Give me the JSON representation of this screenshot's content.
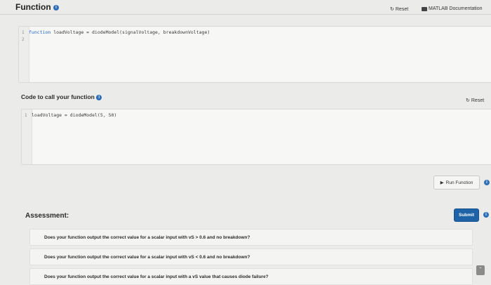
{
  "header": {
    "title": "Function",
    "reset_label": "Reset",
    "docs_label": "MATLAB Documentation"
  },
  "function_editor": {
    "lines": [
      {
        "num": "1",
        "keyword": "function",
        "rest": " loadVoltage = diodeModel(signalVoltage, breakdownVoltage)"
      },
      {
        "num": "2",
        "keyword": "",
        "rest": ""
      }
    ]
  },
  "call_section": {
    "title": "Code to call your function",
    "reset_label": "Reset",
    "lines": [
      {
        "num": "1",
        "text": "loadVoltage = diodeModel(5, 50)"
      }
    ]
  },
  "run_button": {
    "label": "Run Function"
  },
  "assessment": {
    "title": "Assessment:",
    "submit_label": "Submit",
    "tests": [
      "Does your function output the correct value for a scalar input with vS > 0.6 and no breakdown?",
      "Does your function output the correct value for a scalar input with vS < 0.6 and no breakdown?",
      "Does your function output the correct value for a scalar input with a vS value that causes diode failure?"
    ]
  },
  "icons": {
    "info": "info-icon",
    "reset": "refresh-icon",
    "docs": "book-icon",
    "run": "play-icon",
    "expand": "chevron-up-icon"
  },
  "colors": {
    "accent": "#1e63a8",
    "info": "#2d6fb6"
  }
}
